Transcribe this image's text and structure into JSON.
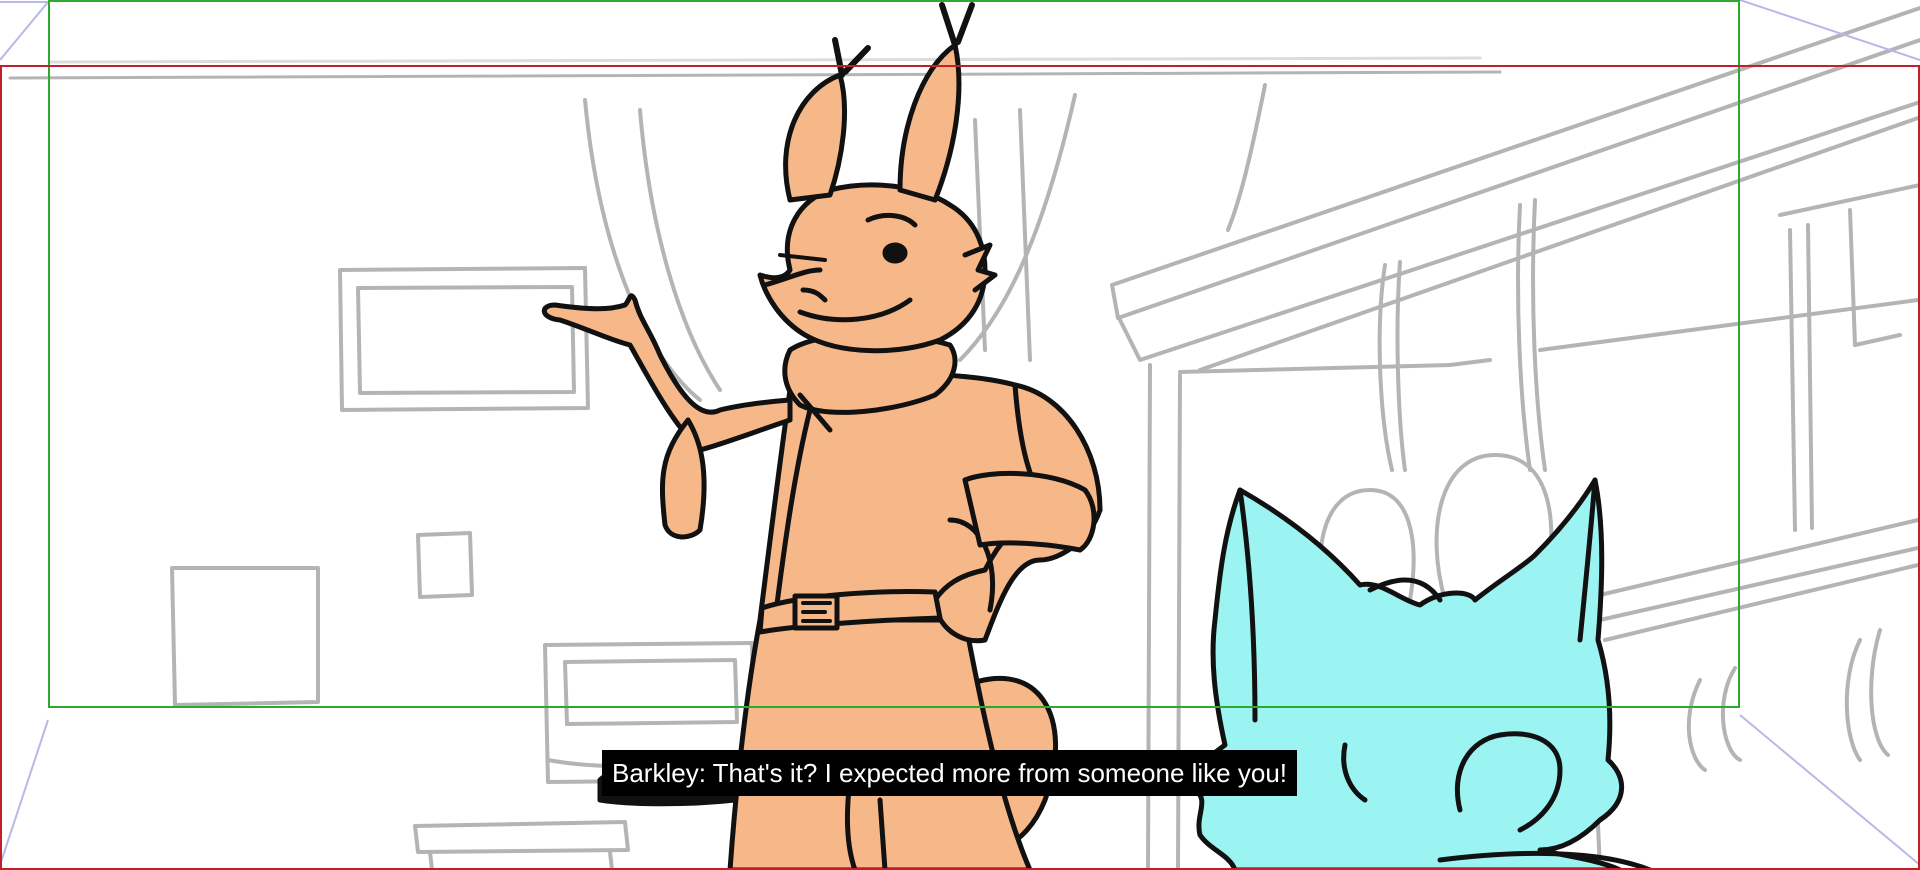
{
  "subtitle": {
    "speaker": "Barkley",
    "line": "That's it? I expected more from someone like you!",
    "text": "Barkley: That's it? I expected more from someone like you!"
  },
  "guides": {
    "safe_area_color": "#2fa82f",
    "frame_color": "#c0202b",
    "perspective_color": "#b8b8e8"
  },
  "characters": {
    "barkley_color": "#f7b889",
    "blue_character_color": "#9bf4f2"
  },
  "sketch_color": "#b4b4b4"
}
